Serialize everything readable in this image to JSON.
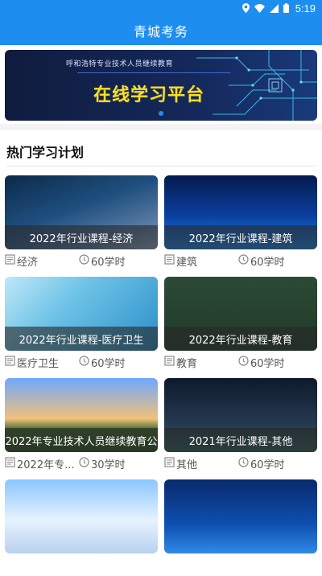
{
  "status_bar": {
    "time": "5:19"
  },
  "app_bar": {
    "title": "青城考务"
  },
  "banner": {
    "subtitle": "呼和浩特专业技术人员继续教育",
    "headline": "在线学习平台"
  },
  "section": {
    "title": "热门学习计划"
  },
  "colors": {
    "primary": "#1d8ef0",
    "headline": "#ffe01a"
  },
  "courses": [
    {
      "caption": "2022年行业课程-经济",
      "category": "经济",
      "hours": "60学时",
      "theme": "finance"
    },
    {
      "caption": "2022年行业课程-建筑",
      "category": "建筑",
      "hours": "60学时",
      "theme": "city"
    },
    {
      "caption": "2022年行业课程-医疗卫生",
      "category": "医疗卫生",
      "hours": "60学时",
      "theme": "molecule"
    },
    {
      "caption": "2022年行业课程-教育",
      "category": "教育",
      "hours": "60学时",
      "theme": "chalkboard"
    },
    {
      "caption": "2022年专业技术人员继续教育公",
      "category": "2022年专...",
      "hours": "30学时",
      "theme": "landscape"
    },
    {
      "caption": "2021年行业课程-其他",
      "category": "其他",
      "hours": "60学时",
      "theme": "stadium"
    },
    {
      "caption": "",
      "category": "",
      "hours": "",
      "theme": "architecture"
    },
    {
      "caption": "",
      "category": "",
      "hours": "",
      "theme": "medical-tech"
    }
  ]
}
